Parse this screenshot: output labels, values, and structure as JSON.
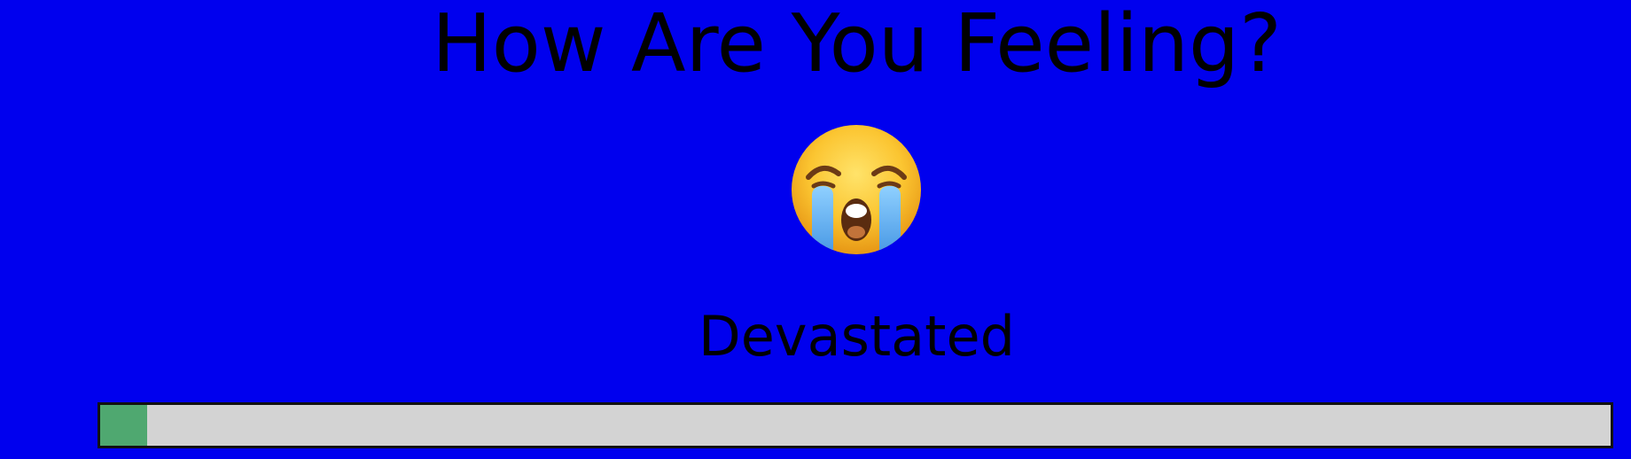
{
  "title": "How Are You Feeling?",
  "mood": {
    "emoji": "loudly-crying-face-icon",
    "label": "Devastated"
  },
  "slider": {
    "value_fraction": 0.031,
    "fill_color": "#4fa870",
    "track_color": "#d3d3d3"
  },
  "colors": {
    "background": "#0000ee",
    "text": "#000000"
  }
}
